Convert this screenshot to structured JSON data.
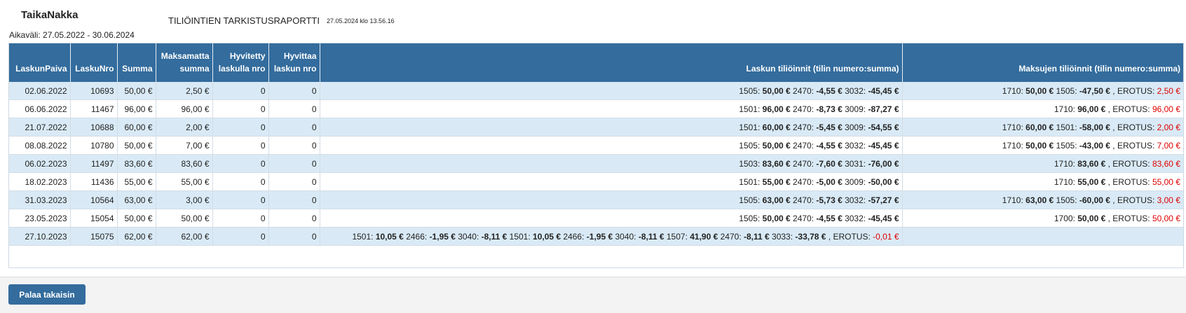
{
  "header": {
    "company": "TaikaNakka",
    "report_title": "TILIÖINTIEN TARKISTUSRAPORTTI",
    "report_date": "27.05.2024 klo 13.56.16",
    "period": "Aikaväli: 27.05.2022 - 30.06.2024"
  },
  "table": {
    "columns": [
      {
        "label": "LaskunPaiva"
      },
      {
        "label": "LaskuNro"
      },
      {
        "label": "Summa"
      },
      {
        "label": "Maksamatta summa"
      },
      {
        "label": "Hyvitetty laskulla nro"
      },
      {
        "label": "Hyvittaa laskun nro"
      },
      {
        "label": "Laskun tiliöinnit (tilin numero:summa)"
      },
      {
        "label": "Maksujen tiliöinnit (tilin numero:summa)"
      }
    ],
    "rows": [
      {
        "date": "02.06.2022",
        "nro": "10693",
        "summa": "50,00 €",
        "maksamatta": "2,50 €",
        "hyvitetty": "0",
        "hyvittaa": "0",
        "laskun": [
          {
            "a": "1505: ",
            "v": "50,00 €"
          },
          {
            "a": " 2470: ",
            "v": "-4,55 €"
          },
          {
            "a": " 3032: ",
            "v": "-45,45 €"
          }
        ],
        "laskun_erotus": "",
        "maksujen": [
          {
            "a": "1710: ",
            "v": "50,00 €"
          },
          {
            "a": " 1505: ",
            "v": "-47,50 €"
          }
        ],
        "maksujen_erotus": "2,50 €"
      },
      {
        "date": "06.06.2022",
        "nro": "11467",
        "summa": "96,00 €",
        "maksamatta": "96,00 €",
        "hyvitetty": "0",
        "hyvittaa": "0",
        "laskun": [
          {
            "a": "1501: ",
            "v": "96,00 €"
          },
          {
            "a": " 2470: ",
            "v": "-8,73 €"
          },
          {
            "a": " 3009: ",
            "v": "-87,27 €"
          }
        ],
        "laskun_erotus": "",
        "maksujen": [
          {
            "a": "1710: ",
            "v": "96,00 €"
          }
        ],
        "maksujen_erotus": "96,00 €"
      },
      {
        "date": "21.07.2022",
        "nro": "10688",
        "summa": "60,00 €",
        "maksamatta": "2,00 €",
        "hyvitetty": "0",
        "hyvittaa": "0",
        "laskun": [
          {
            "a": "1501: ",
            "v": "60,00 €"
          },
          {
            "a": " 2470: ",
            "v": "-5,45 €"
          },
          {
            "a": " 3009: ",
            "v": "-54,55 €"
          }
        ],
        "laskun_erotus": "",
        "maksujen": [
          {
            "a": "1710: ",
            "v": "60,00 €"
          },
          {
            "a": " 1501: ",
            "v": "-58,00 €"
          }
        ],
        "maksujen_erotus": "2,00 €"
      },
      {
        "date": "08.08.2022",
        "nro": "10780",
        "summa": "50,00 €",
        "maksamatta": "7,00 €",
        "hyvitetty": "0",
        "hyvittaa": "0",
        "laskun": [
          {
            "a": "1505: ",
            "v": "50,00 €"
          },
          {
            "a": " 2470: ",
            "v": "-4,55 €"
          },
          {
            "a": " 3032: ",
            "v": "-45,45 €"
          }
        ],
        "laskun_erotus": "",
        "maksujen": [
          {
            "a": "1710: ",
            "v": "50,00 €"
          },
          {
            "a": " 1505: ",
            "v": "-43,00 €"
          }
        ],
        "maksujen_erotus": "7,00 €"
      },
      {
        "date": "06.02.2023",
        "nro": "11497",
        "summa": "83,60 €",
        "maksamatta": "83,60 €",
        "hyvitetty": "0",
        "hyvittaa": "0",
        "laskun": [
          {
            "a": "1503: ",
            "v": "83,60 €"
          },
          {
            "a": " 2470: ",
            "v": "-7,60 €"
          },
          {
            "a": " 3031: ",
            "v": "-76,00 €"
          }
        ],
        "laskun_erotus": "",
        "maksujen": [
          {
            "a": "1710: ",
            "v": "83,60 €"
          }
        ],
        "maksujen_erotus": "83,60 €"
      },
      {
        "date": "18.02.2023",
        "nro": "11436",
        "summa": "55,00 €",
        "maksamatta": "55,00 €",
        "hyvitetty": "0",
        "hyvittaa": "0",
        "laskun": [
          {
            "a": "1501: ",
            "v": "55,00 €"
          },
          {
            "a": " 2470: ",
            "v": "-5,00 €"
          },
          {
            "a": " 3009: ",
            "v": "-50,00 €"
          }
        ],
        "laskun_erotus": "",
        "maksujen": [
          {
            "a": "1710: ",
            "v": "55,00 €"
          }
        ],
        "maksujen_erotus": "55,00 €"
      },
      {
        "date": "31.03.2023",
        "nro": "10564",
        "summa": "63,00 €",
        "maksamatta": "3,00 €",
        "hyvitetty": "0",
        "hyvittaa": "0",
        "laskun": [
          {
            "a": "1505: ",
            "v": "63,00 €"
          },
          {
            "a": " 2470: ",
            "v": "-5,73 €"
          },
          {
            "a": " 3032: ",
            "v": "-57,27 €"
          }
        ],
        "laskun_erotus": "",
        "maksujen": [
          {
            "a": "1710: ",
            "v": "63,00 €"
          },
          {
            "a": " 1505: ",
            "v": "-60,00 €"
          }
        ],
        "maksujen_erotus": "3,00 €"
      },
      {
        "date": "23.05.2023",
        "nro": "15054",
        "summa": "50,00 €",
        "maksamatta": "50,00 €",
        "hyvitetty": "0",
        "hyvittaa": "0",
        "laskun": [
          {
            "a": "1505: ",
            "v": "50,00 €"
          },
          {
            "a": " 2470: ",
            "v": "-4,55 €"
          },
          {
            "a": " 3032: ",
            "v": "-45,45 €"
          }
        ],
        "laskun_erotus": "",
        "maksujen": [
          {
            "a": "1700: ",
            "v": "50,00 €"
          }
        ],
        "maksujen_erotus": "50,00 €"
      },
      {
        "date": "27.10.2023",
        "nro": "15075",
        "summa": "62,00 €",
        "maksamatta": "62,00 €",
        "hyvitetty": "0",
        "hyvittaa": "0",
        "laskun": [
          {
            "a": "1501: ",
            "v": "10,05 €"
          },
          {
            "a": " 2466: ",
            "v": "-1,95 €"
          },
          {
            "a": " 3040: ",
            "v": "-8,11 €"
          },
          {
            "a": " 1501: ",
            "v": "10,05 €"
          },
          {
            "a": " 2466: ",
            "v": "-1,95 €"
          },
          {
            "a": " 3040: ",
            "v": "-8,11 €"
          },
          {
            "a": " 1507: ",
            "v": "41,90 €"
          },
          {
            "a": " 2470: ",
            "v": "-8,11 €"
          },
          {
            "a": " 3033: ",
            "v": "-33,78 €"
          }
        ],
        "laskun_erotus": "-0,01 €",
        "maksujen": [],
        "maksujen_erotus": ""
      }
    ],
    "erotus_label": " , EROTUS: "
  },
  "footer": {
    "back_label": "Palaa takaisin"
  },
  "colors": {
    "header_bg": "#336c9d",
    "row_alt_bg": "#d9eaf6",
    "erotus_red": "#e00000"
  }
}
